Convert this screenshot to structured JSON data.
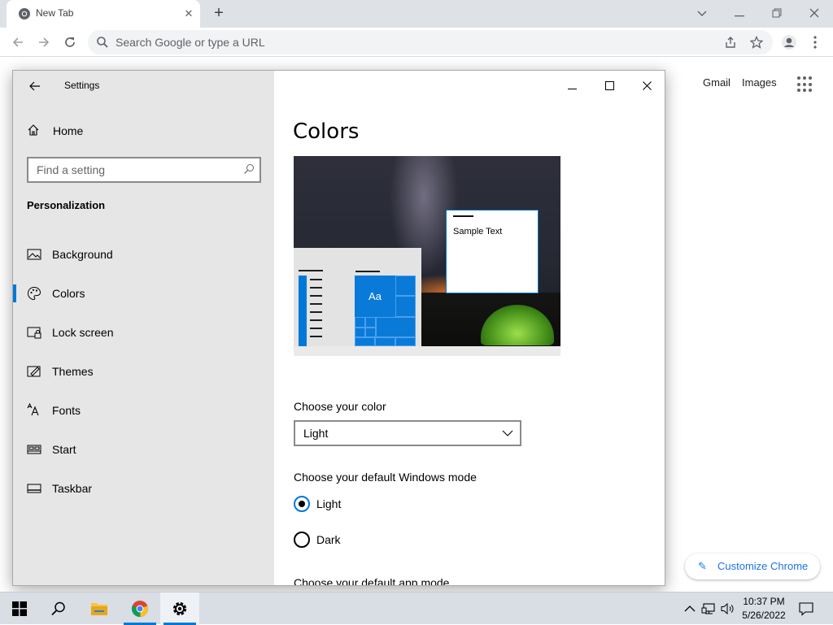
{
  "browser": {
    "tab_title": "New Tab",
    "omnibox_placeholder": "Search Google or type a URL",
    "links": {
      "gmail": "Gmail",
      "images": "Images"
    },
    "customize_label": "Customize Chrome"
  },
  "settings": {
    "window_title": "Settings",
    "home_label": "Home",
    "search_placeholder": "Find a setting",
    "section": "Personalization",
    "nav_items": [
      {
        "label": "Background",
        "icon": "picture-icon"
      },
      {
        "label": "Colors",
        "icon": "palette-icon",
        "active": true
      },
      {
        "label": "Lock screen",
        "icon": "lock-screen-icon"
      },
      {
        "label": "Themes",
        "icon": "themes-icon"
      },
      {
        "label": "Fonts",
        "icon": "fonts-icon"
      },
      {
        "label": "Start",
        "icon": "start-icon"
      },
      {
        "label": "Taskbar",
        "icon": "taskbar-icon"
      }
    ],
    "page_title": "Colors",
    "preview": {
      "sample_text": "Sample Text",
      "tile_text": "Aa"
    },
    "choose_color_label": "Choose your color",
    "choose_color_value": "Light",
    "windows_mode_label": "Choose your default Windows mode",
    "windows_mode_options": [
      "Light",
      "Dark"
    ],
    "windows_mode_selected": "Light",
    "app_mode_label": "Choose your default app mode"
  },
  "taskbar": {
    "time": "10:37 PM",
    "date": "5/26/2022",
    "accent": "#0078d7"
  }
}
